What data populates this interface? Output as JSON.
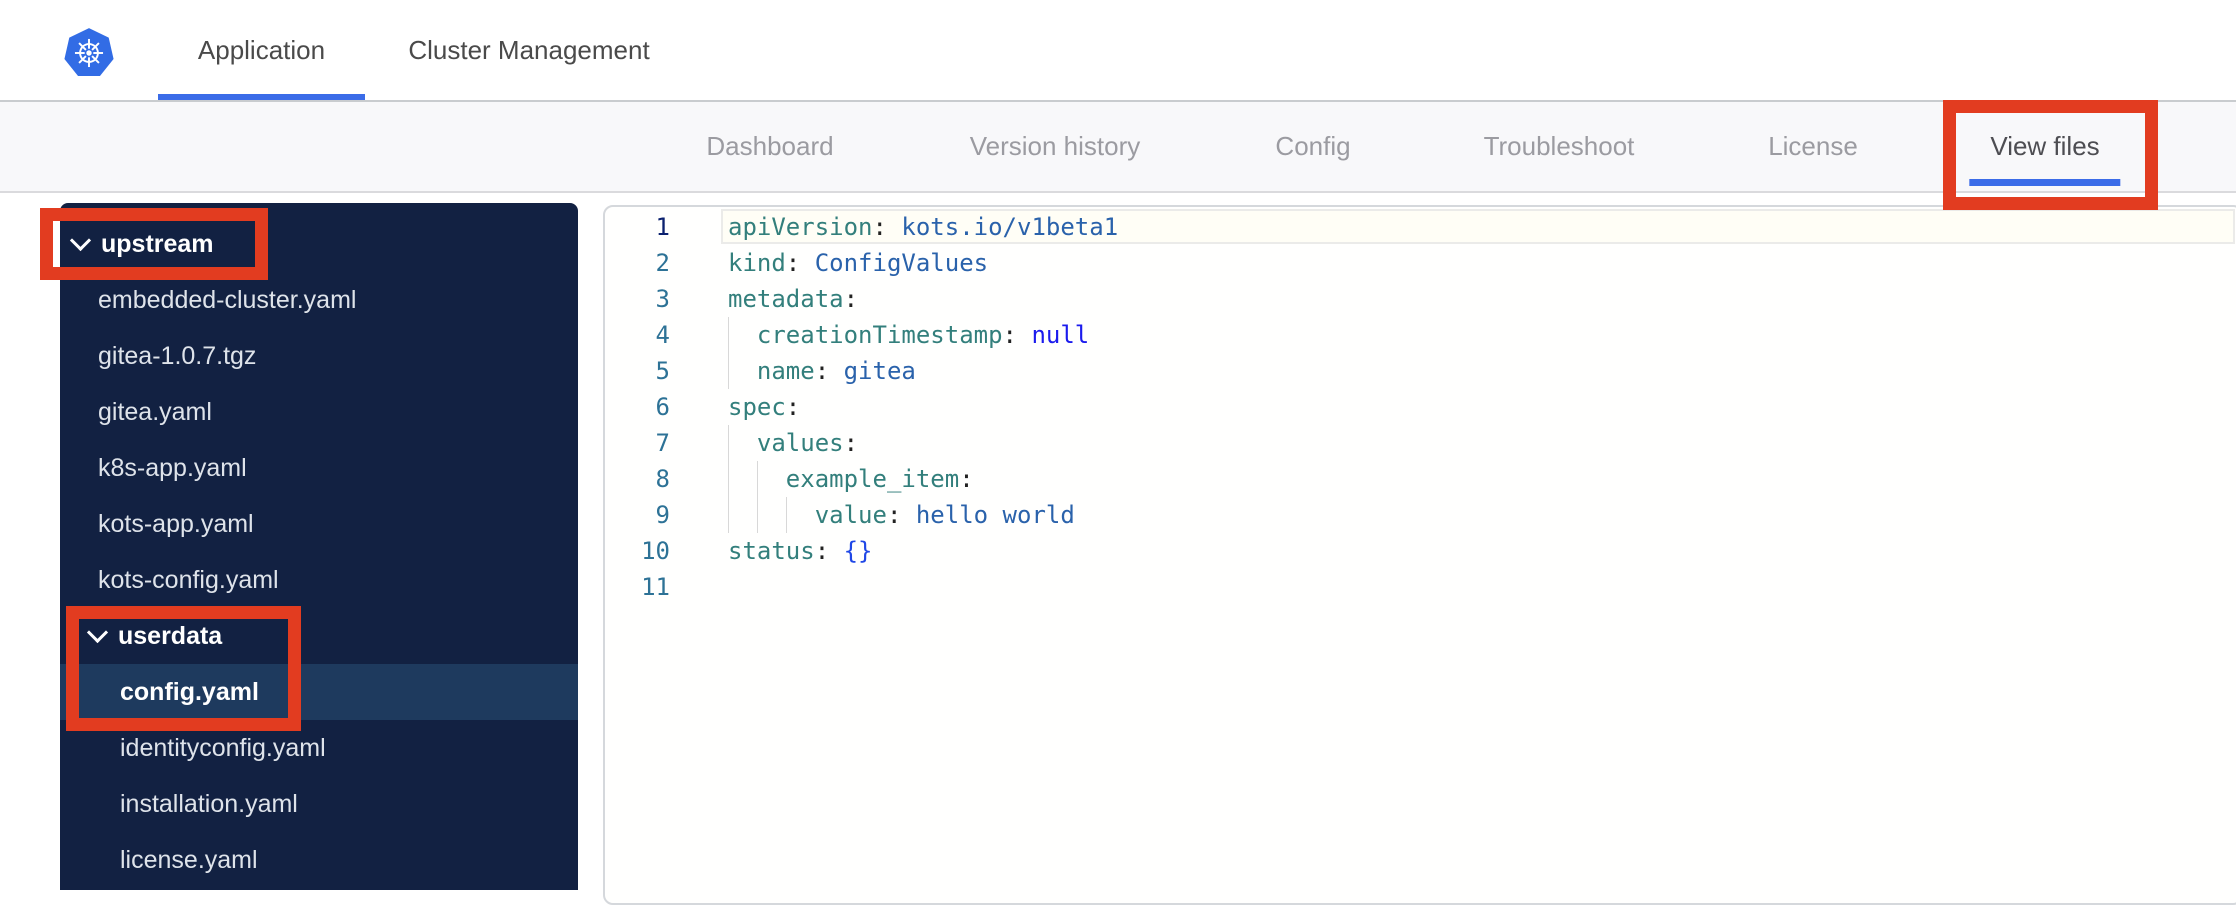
{
  "header": {
    "tabs": [
      {
        "label": "Application",
        "active": true
      },
      {
        "label": "Cluster Management",
        "active": false
      }
    ]
  },
  "subnav": {
    "items": [
      {
        "label": "Dashboard",
        "active": false
      },
      {
        "label": "Version history",
        "active": false
      },
      {
        "label": "Config",
        "active": false
      },
      {
        "label": "Troubleshoot",
        "active": false
      },
      {
        "label": "License",
        "active": false
      },
      {
        "label": "View files",
        "active": true
      }
    ]
  },
  "sidebar": {
    "items": [
      {
        "label": "upstream",
        "type": "folder",
        "level": 0,
        "expanded": true
      },
      {
        "label": "embedded-cluster.yaml",
        "type": "file",
        "level": 1
      },
      {
        "label": "gitea-1.0.7.tgz",
        "type": "file",
        "level": 1
      },
      {
        "label": "gitea.yaml",
        "type": "file",
        "level": 1
      },
      {
        "label": "k8s-app.yaml",
        "type": "file",
        "level": 1
      },
      {
        "label": "kots-app.yaml",
        "type": "file",
        "level": 1
      },
      {
        "label": "kots-config.yaml",
        "type": "file",
        "level": 1
      },
      {
        "label": "userdata",
        "type": "folder",
        "level": 1,
        "expanded": true
      },
      {
        "label": "config.yaml",
        "type": "file",
        "level": 2,
        "selected": true
      },
      {
        "label": "identityconfig.yaml",
        "type": "file",
        "level": 2
      },
      {
        "label": "installation.yaml",
        "type": "file",
        "level": 2
      },
      {
        "label": "license.yaml",
        "type": "file",
        "level": 2
      }
    ]
  },
  "editor": {
    "language": "yaml",
    "lines": [
      {
        "num": 1,
        "active": true,
        "guides": [],
        "tokens": [
          [
            "key",
            "apiVersion"
          ],
          [
            "punc",
            ":"
          ],
          [
            "plain",
            " "
          ],
          [
            "val",
            "kots.io/v1beta1"
          ]
        ]
      },
      {
        "num": 2,
        "guides": [],
        "tokens": [
          [
            "key",
            "kind"
          ],
          [
            "punc",
            ":"
          ],
          [
            "plain",
            " "
          ],
          [
            "val",
            "ConfigValues"
          ]
        ]
      },
      {
        "num": 3,
        "guides": [],
        "tokens": [
          [
            "key",
            "metadata"
          ],
          [
            "punc",
            ":"
          ]
        ]
      },
      {
        "num": 4,
        "guides": [
          0
        ],
        "tokens": [
          [
            "plain",
            "  "
          ],
          [
            "key",
            "creationTimestamp"
          ],
          [
            "punc",
            ":"
          ],
          [
            "plain",
            " "
          ],
          [
            "kw",
            "null"
          ]
        ]
      },
      {
        "num": 5,
        "guides": [
          0
        ],
        "tokens": [
          [
            "plain",
            "  "
          ],
          [
            "key",
            "name"
          ],
          [
            "punc",
            ":"
          ],
          [
            "plain",
            " "
          ],
          [
            "val",
            "gitea"
          ]
        ]
      },
      {
        "num": 6,
        "guides": [],
        "tokens": [
          [
            "key",
            "spec"
          ],
          [
            "punc",
            ":"
          ]
        ]
      },
      {
        "num": 7,
        "guides": [
          0
        ],
        "tokens": [
          [
            "plain",
            "  "
          ],
          [
            "key",
            "values"
          ],
          [
            "punc",
            ":"
          ]
        ]
      },
      {
        "num": 8,
        "guides": [
          0,
          2
        ],
        "tokens": [
          [
            "plain",
            "    "
          ],
          [
            "key",
            "example_item"
          ],
          [
            "punc",
            ":"
          ]
        ]
      },
      {
        "num": 9,
        "guides": [
          0,
          2,
          4
        ],
        "tokens": [
          [
            "plain",
            "      "
          ],
          [
            "key",
            "value"
          ],
          [
            "punc",
            ":"
          ],
          [
            "plain",
            " "
          ],
          [
            "val",
            "hello world"
          ]
        ]
      },
      {
        "num": 10,
        "guides": [],
        "tokens": [
          [
            "key",
            "status"
          ],
          [
            "punc",
            ":"
          ],
          [
            "plain",
            " "
          ],
          [
            "brk",
            "{}"
          ]
        ]
      },
      {
        "num": 11,
        "guides": [],
        "tokens": []
      }
    ]
  },
  "annotations": {
    "color": "#e23c20",
    "boxes": [
      {
        "name": "upstream-folder"
      },
      {
        "name": "userdata-and-config-yaml"
      },
      {
        "name": "view-files-tab"
      }
    ]
  },
  "colors": {
    "brand_blue": "#326ce5",
    "tab_underline": "#3b6ce8",
    "header_text": "#4a4a4a",
    "subnav_inactive": "#9b9ba1",
    "subnav_active": "#4d4d52",
    "sidebar_bg": "#122142",
    "sidebar_selected_bg": "#1e3a5e",
    "annotation_red": "#e23c20",
    "code_key": "#337f7c",
    "code_value": "#2a62ab",
    "code_keyword": "#1b1bed",
    "code_bracket": "#1f47e6",
    "gutter": "#2d7296",
    "gutter_active": "#0b216f"
  }
}
